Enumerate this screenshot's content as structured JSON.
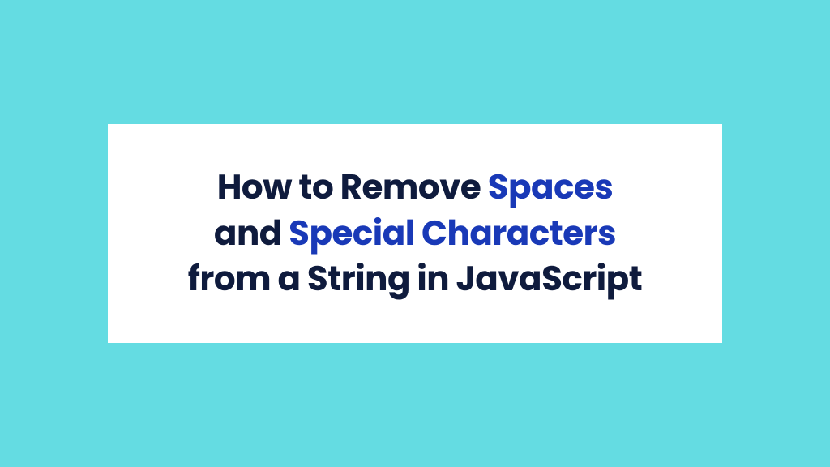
{
  "title": {
    "part1": "How to Remove ",
    "highlight1": "Spaces",
    "part2": " and ",
    "highlight2": "Special Characters",
    "part3": " from a String in JavaScript"
  },
  "colors": {
    "background": "#64DCE2",
    "card": "#FFFFFF",
    "text": "#0F1B3D",
    "highlight": "#1939B7"
  }
}
